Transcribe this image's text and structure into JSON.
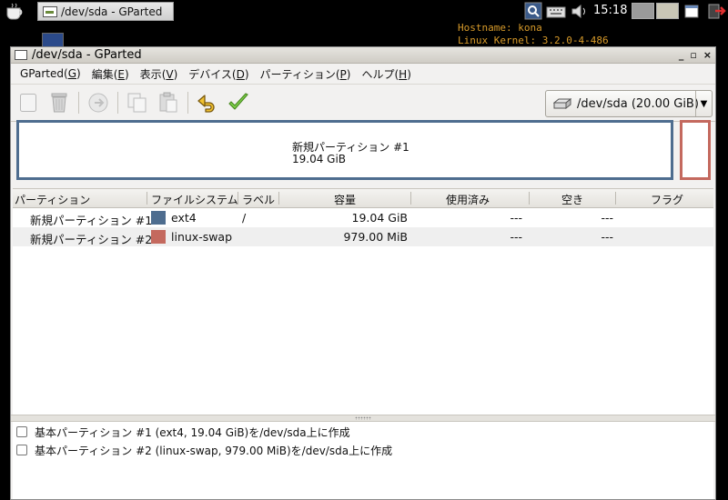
{
  "taskbar": {
    "task_title": "/dev/sda - GParted",
    "clock": "15:18"
  },
  "conky": {
    "line1": "Hostname: kona",
    "line2": "Linux Kernel: 3.2.0-4-486"
  },
  "window": {
    "title": "/dev/sda - GParted",
    "controls": [
      "_",
      "▫",
      "×"
    ]
  },
  "menu": [
    {
      "label": "GParted",
      "key": "G"
    },
    {
      "label": "編集",
      "key": "E"
    },
    {
      "label": "表示",
      "key": "V"
    },
    {
      "label": "デバイス",
      "key": "D"
    },
    {
      "label": "パーティション",
      "key": "P"
    },
    {
      "label": "ヘルプ",
      "key": "H"
    }
  ],
  "device": {
    "label": "/dev/sda  (20.00 GiB)"
  },
  "disk_map": {
    "p1_name": "新規パーティション #1",
    "p1_size": "19.04 GiB"
  },
  "columns": [
    "パーティション",
    "ファイルシステム",
    "ラベル",
    "容量",
    "使用済み",
    "空き",
    "フラグ"
  ],
  "partitions": [
    {
      "name": "新規パーティション #1",
      "fs": "ext4",
      "color": "#4e6d8f",
      "label": "/",
      "size": "19.04 GiB",
      "used": "---",
      "free": "---",
      "flags": ""
    },
    {
      "name": "新規パーティション #2",
      "fs": "linux-swap",
      "color": "#c4695e",
      "label": "",
      "size": "979.00 MiB",
      "used": "---",
      "free": "---",
      "flags": ""
    }
  ],
  "operations": [
    "基本パーティション #1 (ext4, 19.04 GiB)を/dev/sda上に作成",
    "基本パーティション #2 (linux-swap, 979.00 MiB)を/dev/sda上に作成"
  ]
}
